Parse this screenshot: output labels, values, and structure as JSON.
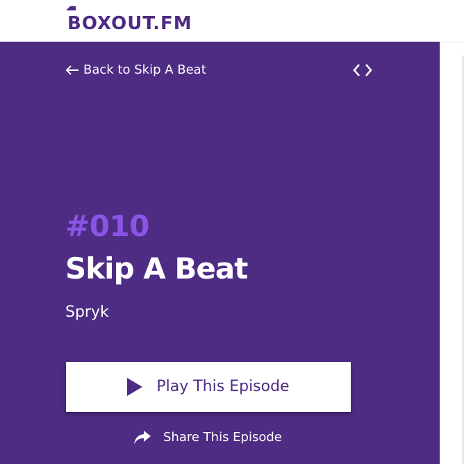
{
  "header": {
    "logo_text": "BOXOUT.FM"
  },
  "nav": {
    "back_label": "Back to Skip A Beat",
    "embed_icon": "code-icon"
  },
  "episode": {
    "number": "#010",
    "title": "Skip A Beat",
    "artist": "Spryk"
  },
  "actions": {
    "play_label": "Play This Episode",
    "share_label": "Share This Episode"
  },
  "colors": {
    "brand_purple": "#4e2c84",
    "accent_violet": "#8a55e6",
    "white": "#ffffff"
  }
}
